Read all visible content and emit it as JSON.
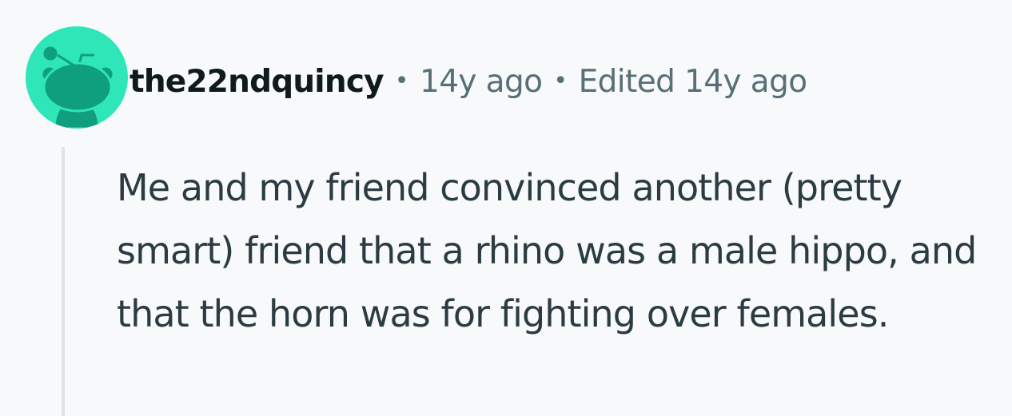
{
  "comment": {
    "avatar_icon": "snoo-avatar-icon",
    "avatar_color": "#2ee6b8",
    "avatar_figure_color": "#0f9f7f",
    "username": "the22ndquincy",
    "separator": "•",
    "posted": "14y ago",
    "edited": "Edited 14y ago",
    "body": "Me and my friend convinced another (pretty smart) friend that a rhino was a male hippo, and that the horn was for fighting over females."
  }
}
